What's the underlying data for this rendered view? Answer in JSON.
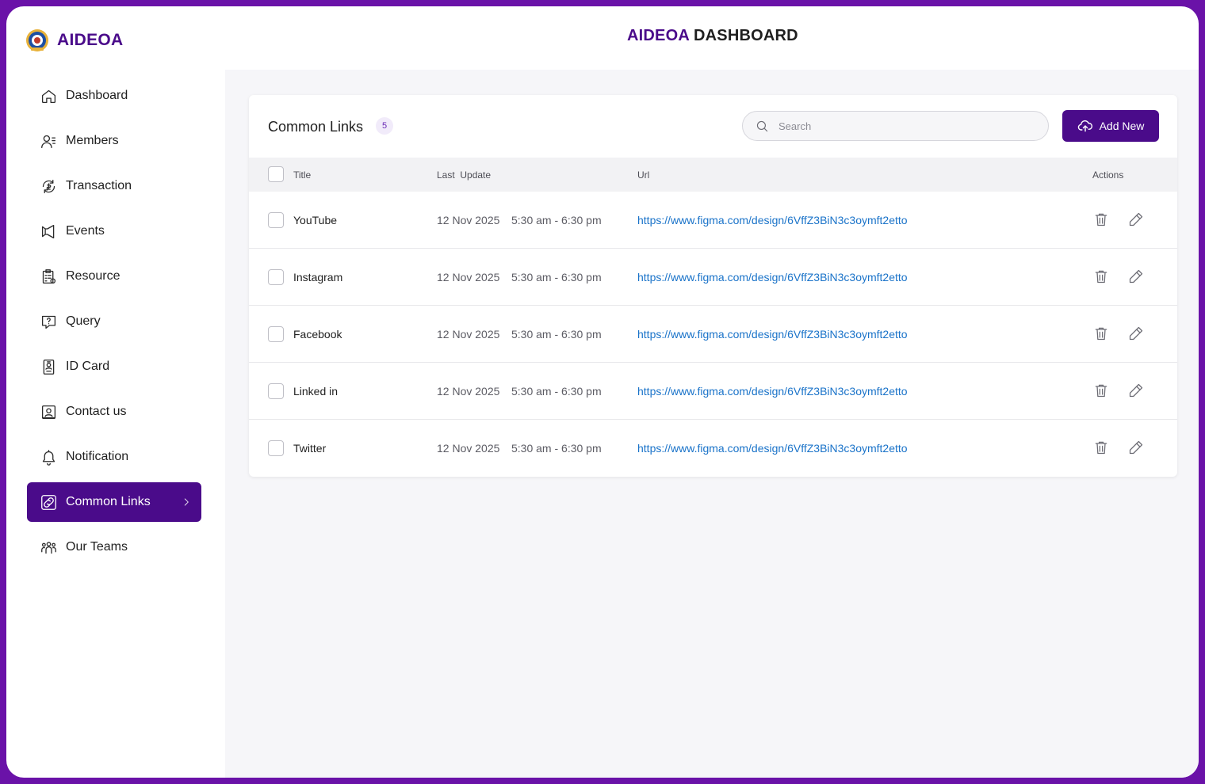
{
  "app": {
    "logo_text": "AIDEOA",
    "title_brand": "AIDEOA",
    "title_rest": "DASHBOARD"
  },
  "colors": {
    "brand": "#4a0b8a",
    "border": "#6a12a8",
    "link": "#1a73c9"
  },
  "sidebar": {
    "items": [
      {
        "label": "Dashboard",
        "icon": "home-icon"
      },
      {
        "label": "Members",
        "icon": "members-icon"
      },
      {
        "label": "Transaction",
        "icon": "transaction-icon"
      },
      {
        "label": "Events",
        "icon": "megaphone-icon"
      },
      {
        "label": "Resource",
        "icon": "clipboard-icon"
      },
      {
        "label": "Query",
        "icon": "question-icon"
      },
      {
        "label": "ID Card",
        "icon": "id-card-icon"
      },
      {
        "label": "Contact us",
        "icon": "contact-icon"
      },
      {
        "label": "Notification",
        "icon": "bell-icon"
      },
      {
        "label": "Common Links",
        "icon": "link-icon",
        "active": true
      },
      {
        "label": "Our Teams",
        "icon": "team-icon"
      }
    ]
  },
  "card": {
    "title": "Common Links",
    "count": "5",
    "search_placeholder": "Search",
    "add_label": "Add New"
  },
  "table": {
    "headers": {
      "title": "Title",
      "last_update": "Last  Update",
      "url": "Url",
      "actions": "Actions"
    },
    "rows": [
      {
        "title": "YouTube",
        "date": "12 Nov 2025",
        "time": "5:30 am - 6:30 pm",
        "url": "https://www.figma.com/design/6VffZ3BiN3c3oymft2etto"
      },
      {
        "title": "Instagram",
        "date": "12 Nov 2025",
        "time": "5:30 am - 6:30 pm",
        "url": "https://www.figma.com/design/6VffZ3BiN3c3oymft2etto"
      },
      {
        "title": "Facebook",
        "date": "12 Nov 2025",
        "time": "5:30 am - 6:30 pm",
        "url": "https://www.figma.com/design/6VffZ3BiN3c3oymft2etto"
      },
      {
        "title": "Linked in",
        "date": "12 Nov 2025",
        "time": "5:30 am - 6:30 pm",
        "url": "https://www.figma.com/design/6VffZ3BiN3c3oymft2etto"
      },
      {
        "title": "Twitter",
        "date": "12 Nov 2025",
        "time": "5:30 am - 6:30 pm",
        "url": "https://www.figma.com/design/6VffZ3BiN3c3oymft2etto"
      }
    ]
  }
}
